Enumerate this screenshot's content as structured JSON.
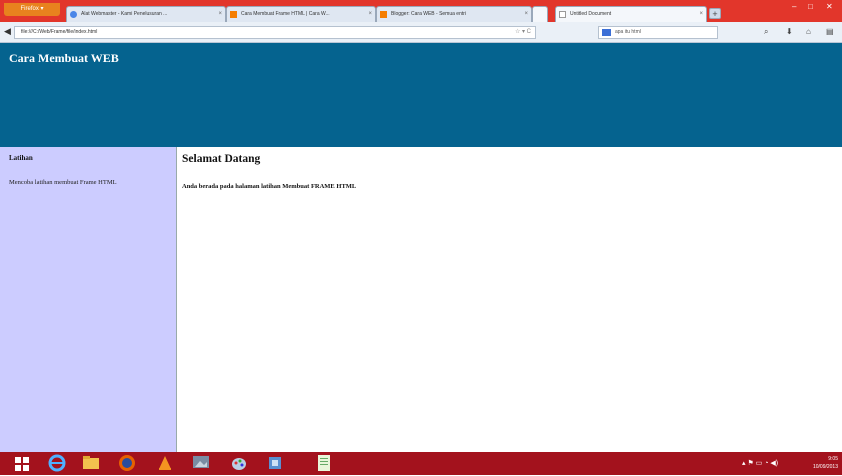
{
  "browser": {
    "menu_button": "Firefox ▾",
    "tabs": [
      {
        "title": "Alat Webmaster - Kami Penelusuran ..."
      },
      {
        "title": "Cara Membuat Frame HTML | Cara W..."
      },
      {
        "title": "Blogger: Cara WEB - Semua entri"
      },
      {
        "title": "Untitled Document"
      }
    ],
    "new_tab": "+",
    "window_controls": {
      "minimize": "–",
      "maximize": "□",
      "close": "✕"
    },
    "url": "file:///C:/Web/Frame/file/index.html",
    "search_placeholder": "apa itu html",
    "colors": {
      "titlebar": "#e2362b",
      "taskbar": "#a3121d",
      "header": "#05638f",
      "sidebar": "#ccccff"
    }
  },
  "page": {
    "header_title": "Cara Membuat WEB",
    "sidebar": {
      "title": "Latihan",
      "link": "Mencoba latihan membuat Frame HTML"
    },
    "main": {
      "heading": "Selamat Datang",
      "body": "Anda berada pada halaman latihan Membuat FRAME HTML"
    }
  },
  "taskbar": {
    "apps": [
      "windows-start",
      "internet-explorer",
      "file-explorer",
      "firefox",
      "vlc",
      "photos",
      "paint",
      "utility",
      "notepad"
    ],
    "time": "9:05",
    "date": "10/09/2013"
  }
}
